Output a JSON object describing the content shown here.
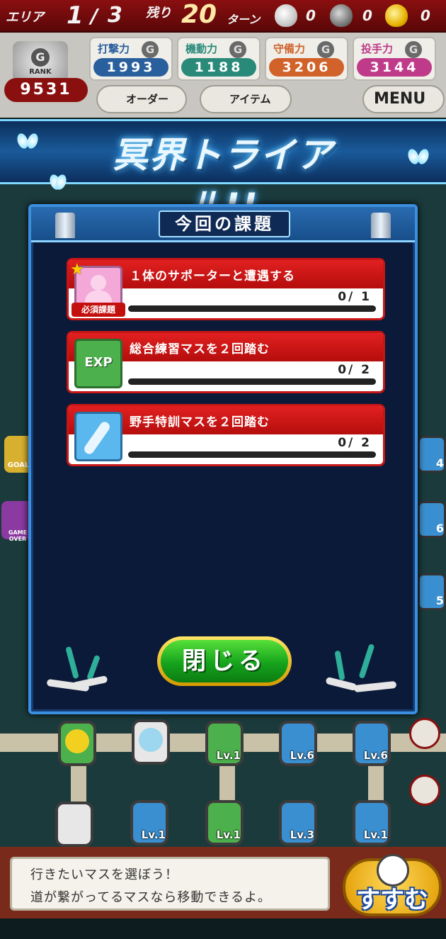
{
  "hud": {
    "area_label": "エリア",
    "area_current": "1",
    "area_sep": "/",
    "area_total": "3",
    "remain_label": "残り",
    "turns": "20",
    "turn_label": "ターン",
    "bag_counts": [
      "0",
      "0",
      "0"
    ],
    "rank_value": "9531",
    "rank_label": "RANK",
    "stats": [
      {
        "label": "打撃力",
        "value": "1993",
        "color": "#2a5f9e"
      },
      {
        "label": "機動力",
        "value": "1188",
        "color": "#2a8a7a"
      },
      {
        "label": "守備力",
        "value": "3206",
        "color": "#d0622a"
      },
      {
        "label": "投手力",
        "value": "3144",
        "color": "#c03a8a"
      }
    ],
    "stat_g": "G",
    "order_label": "オーダー",
    "item_label": "アイテム",
    "menu_label": "MENU"
  },
  "banner": {
    "title": "冥界トライアル!!"
  },
  "modal": {
    "header": "今回の課題",
    "tasks": [
      {
        "label": "１体のサポーターと遭遇する",
        "count": "0/ 1",
        "progress": 0,
        "required": true,
        "required_label": "必須課題",
        "icon": "supporter-icon"
      },
      {
        "label": "総合練習マスを２回踏む",
        "count": "0/ 2",
        "progress": 0,
        "required": false,
        "icon": "exp-icon",
        "icon_text": "EXP"
      },
      {
        "label": "野手特訓マスを２回踏む",
        "count": "0/ 2",
        "progress": 0,
        "required": false,
        "icon": "bat-icon"
      }
    ],
    "close_label": "閉じる"
  },
  "board": {
    "goal_label": "GOAL",
    "gameover_label": "GAME OVER",
    "tile_levels": [
      "Lv.1",
      "Lv.6",
      "Lv.6",
      "Lv.1",
      "Lv.1",
      "Lv.3",
      "Lv.1"
    ],
    "side_levels": [
      "4",
      "6",
      "5"
    ]
  },
  "bottom": {
    "message_line1": "行きたいマスを選ぼう！",
    "message_line2": "道が繋がってるマスなら移動できるよ。",
    "go_label": "すすむ"
  }
}
